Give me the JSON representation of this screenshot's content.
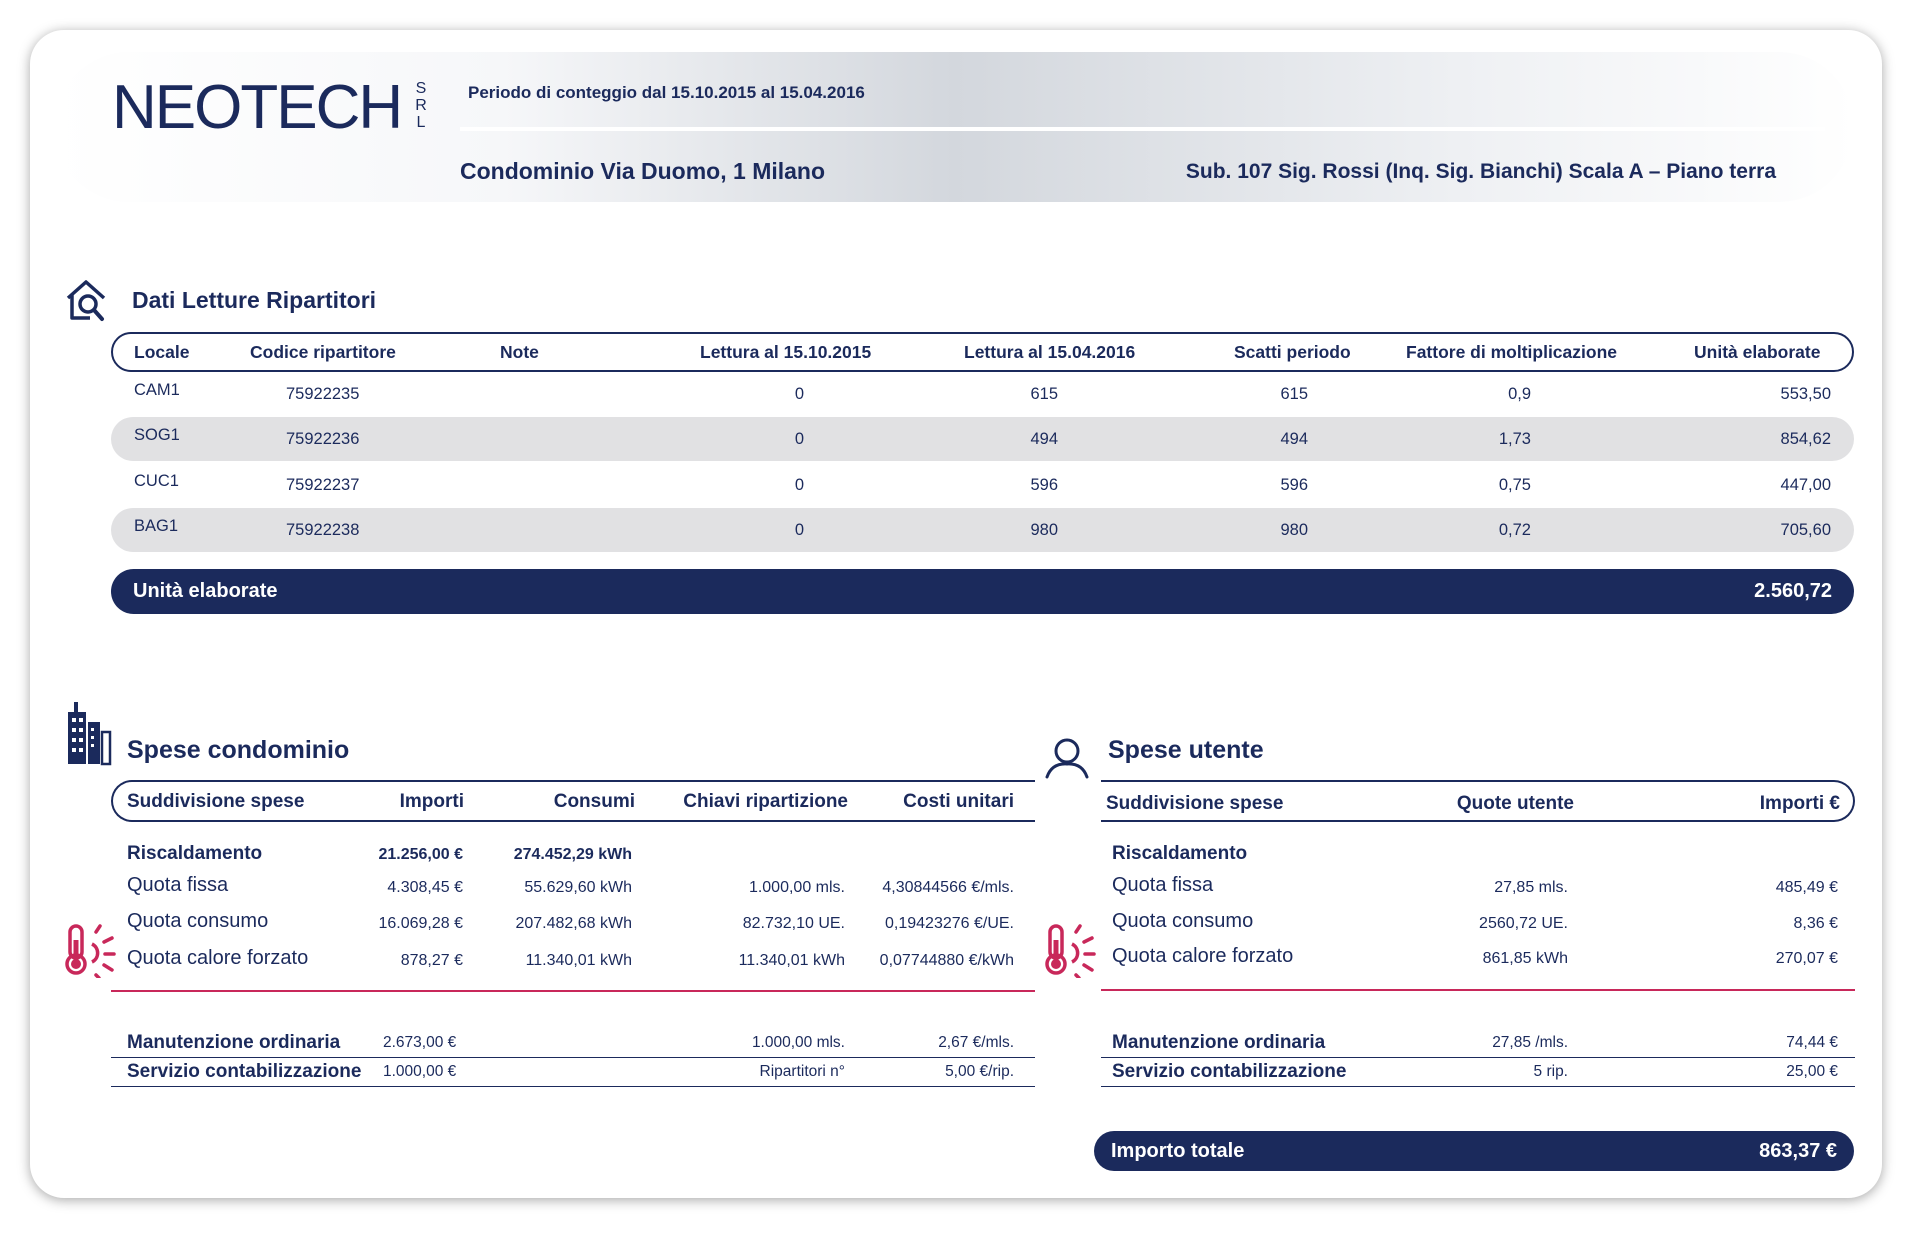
{
  "header": {
    "logo": "NEOTECH",
    "logo_suffix": "SRL",
    "periodo": "Periodo di conteggio dal 15.10.2015 al 15.04.2016",
    "condominio": "Condominio Via Duomo, 1 Milano",
    "sub": "Sub. 107 Sig. Rossi (Inq. Sig. Bianchi) Scala A – Piano terra"
  },
  "letture": {
    "title": "Dati Letture Ripartitori",
    "columns": [
      "Locale",
      "Codice ripartitore",
      "Note",
      "Lettura al 15.10.2015",
      "Lettura al 15.04.2016",
      "Scatti periodo",
      "Fattore di moltiplicazione",
      "Unità elaborate"
    ],
    "rows": [
      [
        "CAM1",
        "75922235",
        "",
        "0",
        "615",
        "615",
        "0,9",
        "553,50"
      ],
      [
        "SOG1",
        "75922236",
        "",
        "0",
        "494",
        "494",
        "1,73",
        "854,62"
      ],
      [
        "CUC1",
        "75922237",
        "",
        "0",
        "596",
        "596",
        "0,75",
        "447,00"
      ],
      [
        "BAG1",
        "75922238",
        "",
        "0",
        "980",
        "980",
        "0,72",
        "705,60"
      ]
    ],
    "total_label": "Unità elaborate",
    "total_value": "2.560,72"
  },
  "spese_condominio": {
    "title": "Spese condominio",
    "columns": [
      "Suddivisione spese",
      "Importi",
      "Consumi",
      "Chiavi ripartizione",
      "Costi unitari"
    ],
    "riscaldamento": [
      "Riscaldamento",
      "21.256,00 €",
      "274.452,29 kWh",
      "",
      ""
    ],
    "rows": [
      [
        "Quota fissa",
        "4.308,45 €",
        "55.629,60 kWh",
        "1.000,00 mls.",
        "4,30844566 €/mls."
      ],
      [
        "Quota consumo",
        "16.069,28 €",
        "207.482,68 kWh",
        "82.732,10 UE.",
        "0,19423276 €/UE."
      ],
      [
        "Quota calore forzato",
        "878,27 €",
        "11.340,01 kWh",
        "11.340,01 kWh",
        "0,07744880 €/kWh"
      ]
    ],
    "extra": [
      [
        "Manutenzione ordinaria",
        "2.673,00 €",
        "",
        "1.000,00 mls.",
        "2,67 €/mls."
      ],
      [
        "Servizio contabilizzazione",
        "1.000,00 €",
        "",
        "Ripartitori n°",
        "5,00 €/rip."
      ]
    ]
  },
  "spese_utente": {
    "title": "Spese utente",
    "columns": [
      "Suddivisione spese",
      "Quote utente",
      "Importi €"
    ],
    "riscaldamento": "Riscaldamento",
    "rows": [
      [
        "Quota fissa",
        "27,85 mls.",
        "485,49 €"
      ],
      [
        "Quota consumo",
        "2560,72 UE.",
        "8,36 €"
      ],
      [
        "Quota calore forzato",
        "861,85 kWh",
        "270,07 €"
      ]
    ],
    "extra": [
      [
        "Manutenzione ordinaria",
        "27,85 /mls.",
        "74,44 €"
      ],
      [
        "Servizio contabilizzazione",
        "5 rip.",
        "25,00 €"
      ]
    ],
    "total_label": "Importo totale",
    "total_value": "863,37 €"
  },
  "icons": {
    "letture": "house-search-icon",
    "condominio": "buildings-icon",
    "utente": "person-icon",
    "thermo": "thermometer-heat-icon"
  },
  "colors": {
    "navy": "#1b2a5c",
    "accent": "#c8285a",
    "row_bg": "#e1e1e3"
  }
}
